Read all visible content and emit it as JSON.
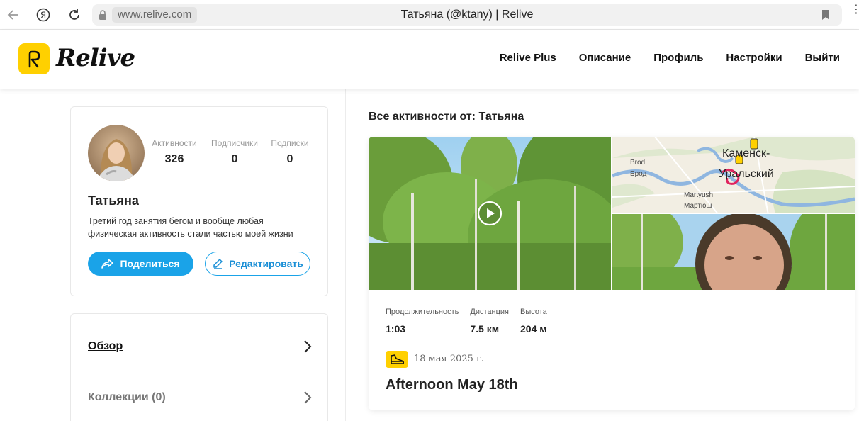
{
  "browser": {
    "url": "www.relive.com",
    "tab_title": "Татьяна (@ktany) | Relive"
  },
  "header": {
    "logo_text": "Relive",
    "nav": [
      "Relive Plus",
      "Описание",
      "Профиль",
      "Настройки",
      "Выйти"
    ]
  },
  "profile": {
    "stats": [
      {
        "label": "Активности",
        "value": "326"
      },
      {
        "label": "Подписчики",
        "value": "0"
      },
      {
        "label": "Подписки",
        "value": "0"
      }
    ],
    "name": "Татьяна",
    "bio": "Третий год занятия бегом и вообще любая физическая активность стали частью моей жизни",
    "share_label": "Поделиться",
    "edit_label": "Редактировать"
  },
  "menu": {
    "items": [
      "Обзор",
      "Коллекции (0)"
    ]
  },
  "activities": {
    "heading": "Все активности от: Татьяна",
    "map_labels": {
      "city_line1": "Каменск-",
      "city_line2": "Уральский",
      "brod_en": "Brod",
      "brod_ru": "Брод",
      "martyush_en": "Martyush",
      "martyush_ru": "Мартюш"
    },
    "stats": [
      {
        "label": "Продолжительность",
        "value": "1:03"
      },
      {
        "label": "Дистанция",
        "value": "7.5 км"
      },
      {
        "label": "Высота",
        "value": "204 м"
      }
    ],
    "date": "18 мая 2025 г.",
    "title": "Afternoon May 18th"
  },
  "colors": {
    "brand_yellow": "#ffd000",
    "accent_blue": "#1aa3e8"
  }
}
